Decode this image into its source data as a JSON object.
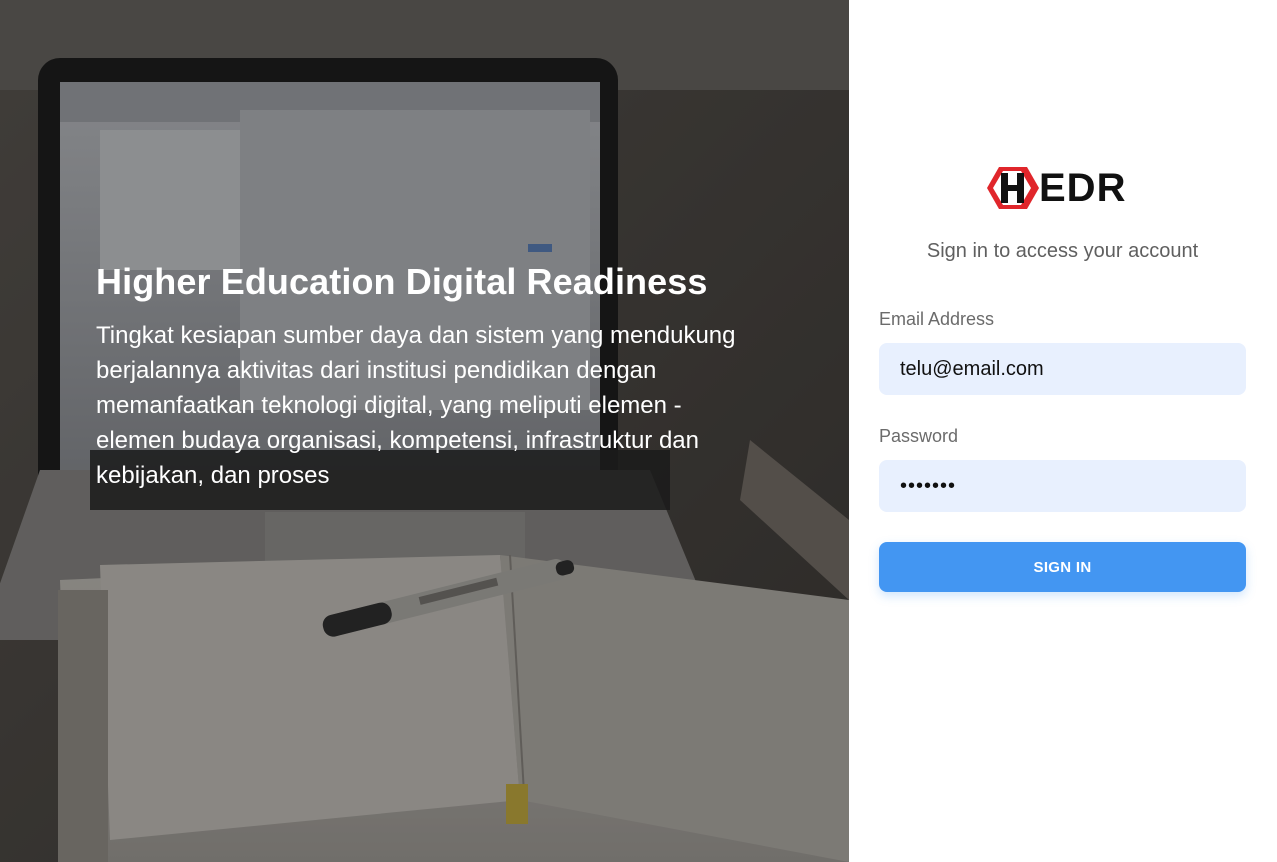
{
  "hero": {
    "title": "Higher Education Digital Readiness",
    "description": "Tingkat kesiapan sumber daya dan sistem yang mendukung berjalannya aktivitas dari institusi pendidikan dengan memanfaatkan teknologi digital, yang meliputi elemen - elemen budaya organisasi, kompetensi, infrastruktur dan kebijakan, dan proses",
    "background_image": "laptop-and-open-notebook-with-pen-photo"
  },
  "login": {
    "logo_text": "EDR",
    "logo_icon": "red-hexagon-h-logo-icon",
    "subtitle": "Sign in to access your account",
    "email_label": "Email Address",
    "email_value": "telu@email.com",
    "password_label": "Password",
    "password_value": "•••••••",
    "signin_label": "SIGN IN"
  },
  "colors": {
    "brand_red": "#e0262b",
    "button_blue": "#4396f2",
    "input_bg": "#e8f0fe"
  }
}
